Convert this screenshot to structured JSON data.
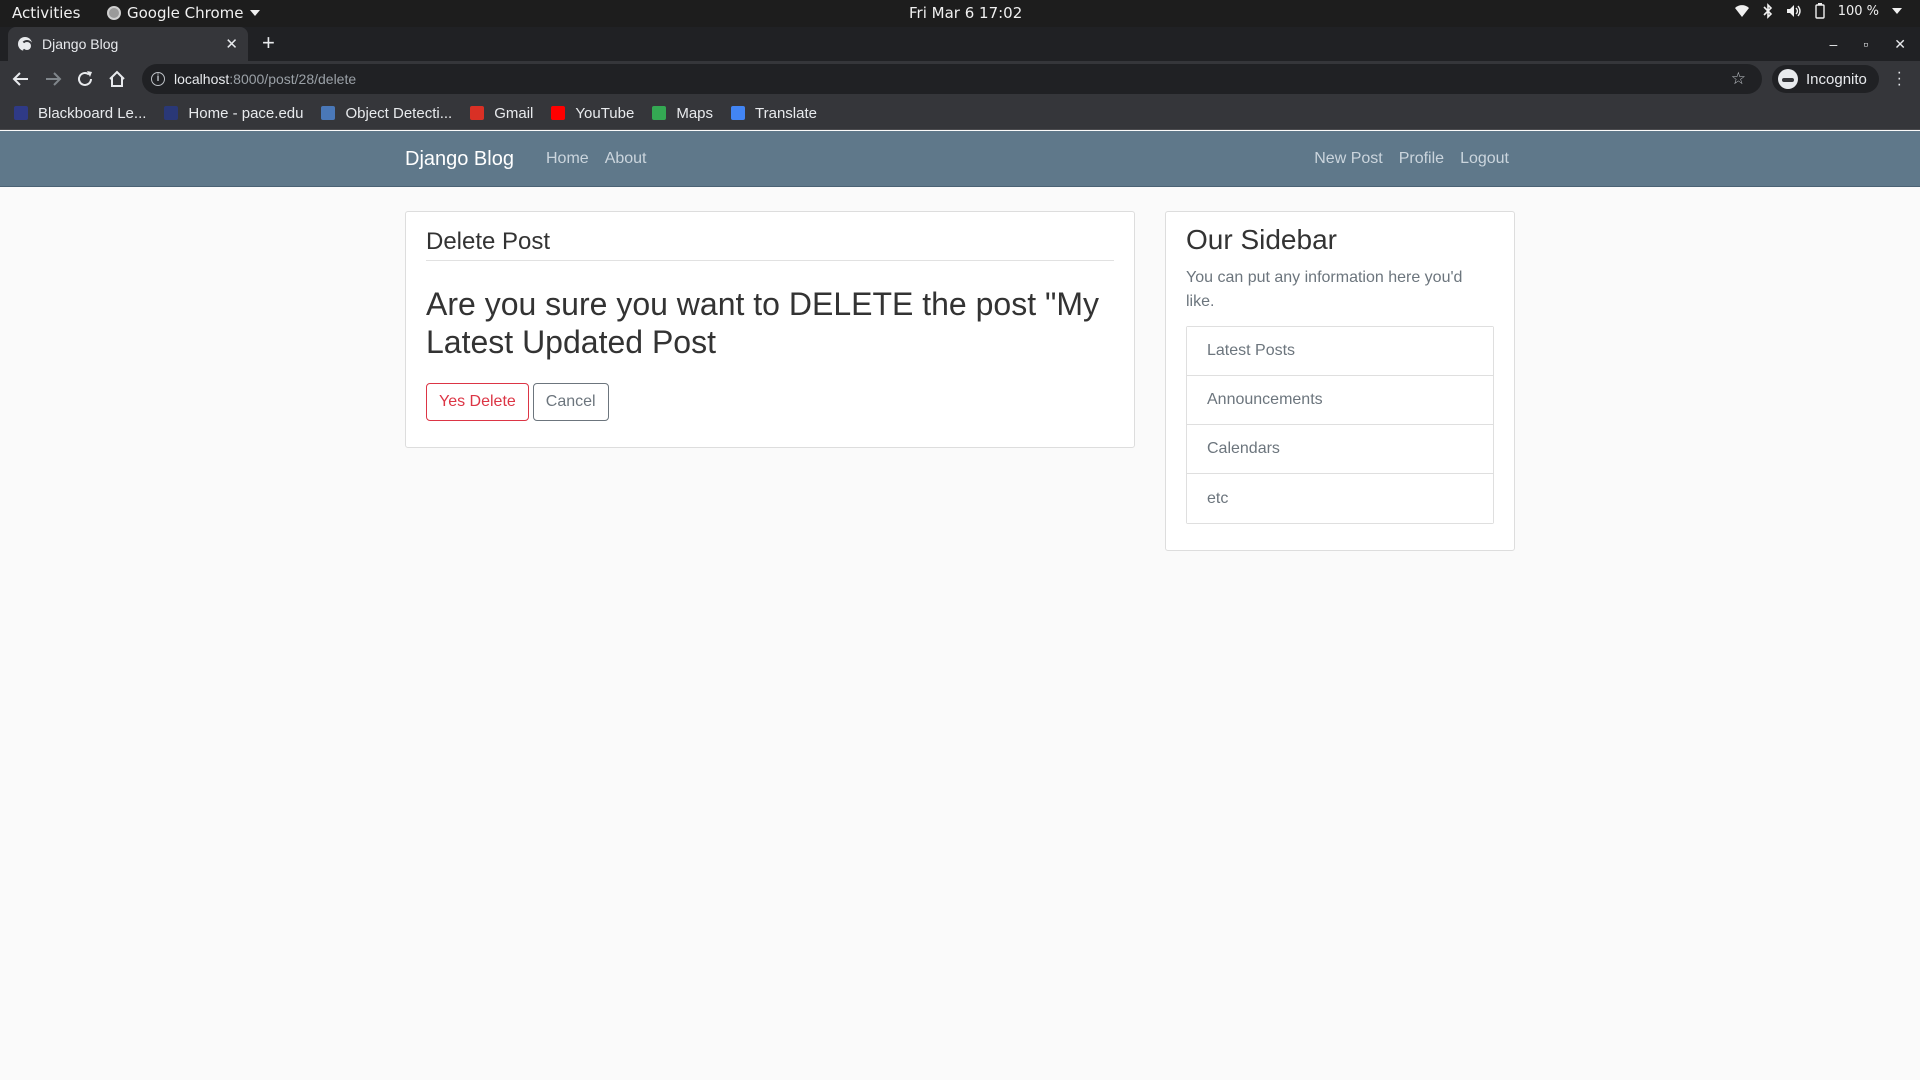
{
  "os_bar": {
    "activities": "Activities",
    "app_name": "Google Chrome",
    "clock": "Fri Mar 6  17:02",
    "battery": "100 %"
  },
  "browser": {
    "tab_title": "Django Blog",
    "url_host": "localhost",
    "url_path": ":8000/post/28/delete",
    "profile": "Incognito",
    "bookmarks": [
      {
        "label": "Blackboard Le...",
        "icon": "blackboard-icon",
        "color": "#2f3a86"
      },
      {
        "label": "Home - pace.edu",
        "icon": "pace-icon",
        "color": "#2a3877"
      },
      {
        "label": "Object Detecti...",
        "icon": "doc-icon",
        "color": "#4a78b8"
      },
      {
        "label": "Gmail",
        "icon": "gmail-icon",
        "color": "#d93025"
      },
      {
        "label": "YouTube",
        "icon": "youtube-icon",
        "color": "#ff0000"
      },
      {
        "label": "Maps",
        "icon": "maps-icon",
        "color": "#34a853"
      },
      {
        "label": "Translate",
        "icon": "translate-icon",
        "color": "#4285f4"
      }
    ]
  },
  "site": {
    "brand": "Django Blog",
    "nav_left": [
      "Home",
      "About"
    ],
    "nav_right": [
      "New Post",
      "Profile",
      "Logout"
    ],
    "nav_color": "#5f788a"
  },
  "main": {
    "legend": "Delete Post",
    "question": "Are you sure you want to DELETE the post \"My Latest Updated Post",
    "delete_label": "Yes Delete",
    "cancel_label": "Cancel"
  },
  "sidebar": {
    "title": "Our Sidebar",
    "text": "You can put any information here you'd like.",
    "items": [
      "Latest Posts",
      "Announcements",
      "Calendars",
      "etc"
    ]
  }
}
